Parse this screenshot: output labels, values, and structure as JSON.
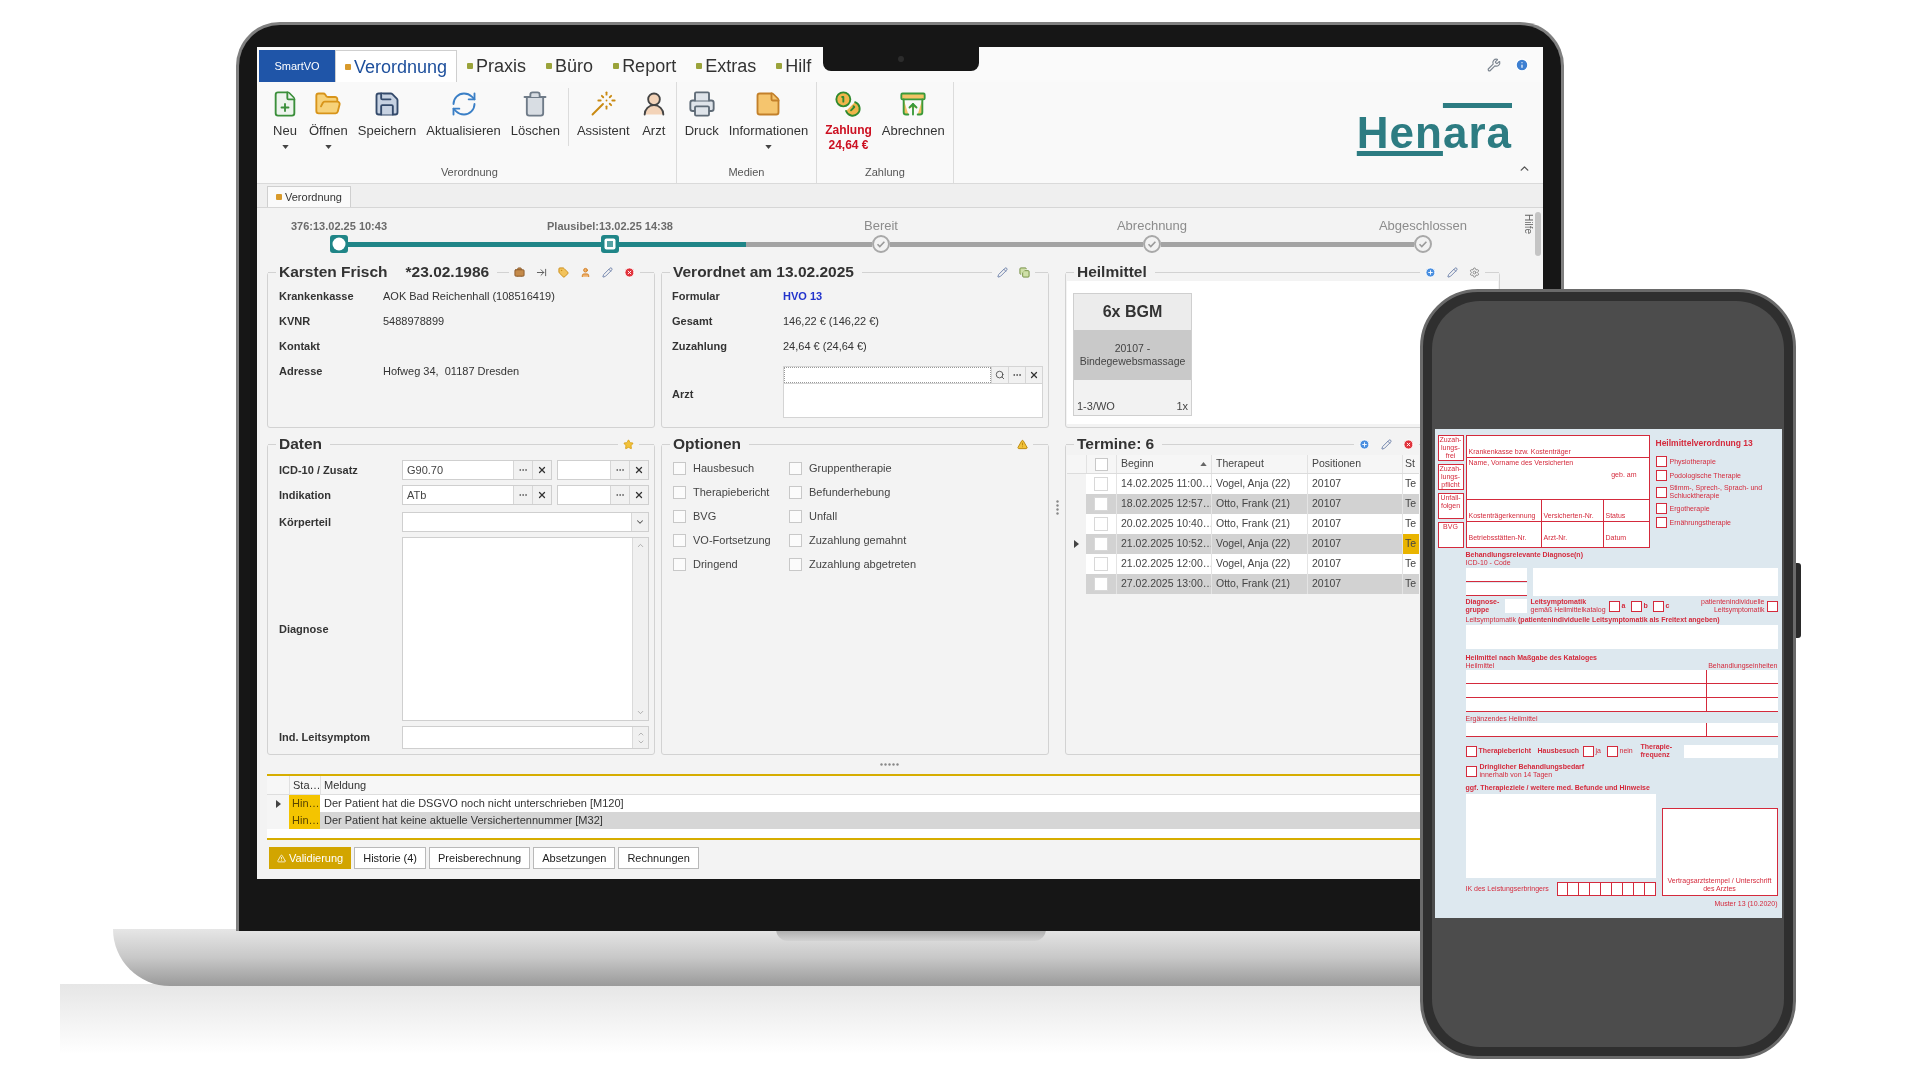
{
  "menu": {
    "app_button": "SmartVO",
    "tabs": [
      {
        "label": "Verordnung",
        "selected": true
      },
      {
        "label": "Praxis",
        "selected": false
      },
      {
        "label": "Büro",
        "selected": false
      },
      {
        "label": "Report",
        "selected": false
      },
      {
        "label": "Extras",
        "selected": false
      },
      {
        "label": "Hilf",
        "selected": false
      }
    ]
  },
  "ribbon": {
    "groups": [
      {
        "label": "Verordnung",
        "sections": [
          [
            {
              "kind": "new",
              "label": "Neu",
              "dropdown": true,
              "highlighted": false
            },
            {
              "kind": "open",
              "label": "Öffnen",
              "dropdown": true,
              "highlighted": false
            },
            {
              "kind": "save",
              "label": "Speichern",
              "dropdown": false,
              "highlighted": false
            },
            {
              "kind": "refresh",
              "label": "Aktualisieren",
              "dropdown": false,
              "highlighted": false
            },
            {
              "kind": "delete",
              "label": "Löschen",
              "dropdown": false,
              "highlighted": false
            }
          ],
          [
            {
              "kind": "assistant",
              "label": "Assistent",
              "dropdown": false,
              "highlighted": false
            },
            {
              "kind": "doctor",
              "label": "Arzt",
              "dropdown": false,
              "highlighted": false
            }
          ]
        ]
      },
      {
        "label": "Medien",
        "sections": [
          [
            {
              "kind": "print",
              "label": "Druck",
              "dropdown": false,
              "highlighted": false
            },
            {
              "kind": "info",
              "label": "Informationen",
              "dropdown": true,
              "highlighted": false
            }
          ]
        ]
      },
      {
        "label": "Zahlung",
        "sections": [
          [
            {
              "kind": "payment",
              "label": "Zahlung",
              "amount": "24,64 €",
              "dropdown": false,
              "highlighted": true
            },
            {
              "kind": "billing",
              "label": "Abrechnen",
              "dropdown": false,
              "highlighted": false
            }
          ]
        ]
      }
    ],
    "logo": {
      "part_1": "Hen",
      "part_2": "ara"
    }
  },
  "document_tab": "Verordnung",
  "timeline": {
    "steps": [
      {
        "label": "376:13.02.25 10:43",
        "completed": true,
        "current": false
      },
      {
        "label": "Plausibel:13.02.25 14:38",
        "completed": false,
        "current": true,
        "level": 0.5
      },
      {
        "label": "Bereit",
        "completed": false,
        "current": false
      },
      {
        "label": "Abrechnung",
        "completed": false,
        "current": false
      },
      {
        "label": "Abgeschlossen",
        "completed": false,
        "current": false
      }
    ]
  },
  "side_tab": "Hilfe",
  "patient": {
    "name": "Karsten Frisch",
    "birthdate": "*23.02.1986",
    "fields": [
      {
        "label": "Krankenkasse",
        "value": "AOK Bad Reichenhall (108516419)"
      },
      {
        "label": "KVNR",
        "value": "5488978899"
      },
      {
        "label": "Kontakt"
      },
      {
        "label": "Adresse",
        "value": "Hofweg 34,  01187 Dresden"
      }
    ]
  },
  "prescription": {
    "title": "Verordnet am 13.02.2025",
    "fields": [
      {
        "kind": "link",
        "label": "Formular",
        "value": "HVO 13"
      },
      {
        "kind": "text",
        "label": "Gesamt",
        "value": "146,22 € (146,22 €)"
      },
      {
        "kind": "text",
        "label": "Zuzahlung",
        "value": "24,64 € (24,64 €)"
      },
      {
        "kind": "lookup",
        "label": "Arzt"
      }
    ]
  },
  "remedies": {
    "title": "Heilmittel",
    "cards": [
      {
        "title": "6x BGM",
        "description": "20107 - Bindegewebsmassage",
        "frequency": "1-3/WO",
        "count": "1x"
      }
    ]
  },
  "data": {
    "title": "Daten",
    "rows": [
      {
        "kind": "pair",
        "label": "ICD-10 / Zusatz",
        "value": "G90.70"
      },
      {
        "kind": "pair",
        "label": "Indikation",
        "value": "ATb"
      },
      {
        "kind": "select",
        "label": "Körperteil"
      },
      {
        "kind": "textarea",
        "label": "Diagnose"
      },
      {
        "kind": "spin",
        "label": "Ind. Leitsymptom"
      }
    ]
  },
  "options": {
    "title": "Optionen",
    "items": [
      {
        "label": "Hausbesuch",
        "checked": false
      },
      {
        "label": "Therapiebericht",
        "checked": false
      },
      {
        "label": "BVG",
        "checked": false
      },
      {
        "label": "VO-Fortsetzung",
        "checked": false
      },
      {
        "label": "Dringend",
        "checked": false
      },
      {
        "label": "Gruppentherapie",
        "checked": false
      },
      {
        "label": "Befunderhebung",
        "checked": false
      },
      {
        "label": "Unfall",
        "checked": false
      },
      {
        "label": "Zuzahlung gemahnt",
        "checked": false
      },
      {
        "label": "Zuzahlung abgetreten",
        "checked": false
      }
    ]
  },
  "appointments": {
    "title": "Termine: 6",
    "select_all": {
      "checked": false
    },
    "columns": [
      {
        "label": "Beginn",
        "sorted": true
      },
      {
        "label": "Therapeut",
        "sorted": false
      },
      {
        "label": "Positionen",
        "sorted": false
      },
      {
        "label": "St",
        "sorted": false
      }
    ],
    "rows": [
      {
        "cells": [
          "14.02.2025 11:00…",
          "Vogel, Anja (22)",
          "20107",
          "Te"
        ],
        "checked": false,
        "current": false
      },
      {
        "cells": [
          "18.02.2025 12:57…",
          "Otto, Frank (21)",
          "20107",
          "Te"
        ],
        "checked": false,
        "current": false
      },
      {
        "cells": [
          "20.02.2025 10:40…",
          "Otto, Frank (21)",
          "20107",
          "Te"
        ],
        "checked": false,
        "current": false
      },
      {
        "cells": [
          "21.02.2025 10:52…",
          "Vogel, Anja (22)",
          "20107",
          "Te"
        ],
        "checked": false,
        "current": true
      },
      {
        "cells": [
          "21.02.2025 12:00…",
          "Vogel, Anja (22)",
          "20107",
          "Te"
        ],
        "checked": false,
        "current": false
      },
      {
        "cells": [
          "27.02.2025 13:00…",
          "Otto, Frank (21)",
          "20107",
          "Te"
        ],
        "checked": false,
        "current": false
      }
    ]
  },
  "messages": {
    "columns": [
      "Sta…",
      "Meldung"
    ],
    "rows": [
      {
        "status": "Hin…",
        "text": "Der Patient hat die DSGVO noch nicht unterschrieben [M120]",
        "current": true,
        "selected": false
      },
      {
        "status": "Hin…",
        "text": "Der Patient hat keine aktuelle Versichertennummer [M32]",
        "current": false,
        "selected": true
      }
    ]
  },
  "bottom_tabs": [
    {
      "label": "Validierung",
      "kind": "warning",
      "selected": true
    },
    {
      "label": "Historie (4)",
      "kind": "plain",
      "selected": false
    },
    {
      "label": "Preisberechnung",
      "kind": "plain",
      "selected": false
    },
    {
      "label": "Absetzungen",
      "kind": "plain",
      "selected": false
    },
    {
      "label": "Rechnungen",
      "kind": "plain",
      "selected": false
    }
  ],
  "phone_form": {
    "side_labels": [
      "Zuzah-lungs-frei",
      "Zuzah-lungs-pflicht",
      "Unfall-folgen",
      "BVG"
    ],
    "insured": {
      "payer": "Krankenkasse bzw. Kostenträger",
      "name": "Name, Vorname des Versicherten",
      "birth": "geb. am",
      "row_3": [
        "Kostenträgerkennung",
        "Versicherten-Nr.",
        "Status"
      ],
      "row_4": [
        "Betriebsstätten-Nr.",
        "Arzt-Nr.",
        "Datum"
      ]
    },
    "title": "Heilmittelverordnung 13",
    "therapies": [
      {
        "label": "Physiotherapie",
        "checked": false
      },
      {
        "label": "Podologische Therapie",
        "checked": false
      },
      {
        "label": "Stimm-, Sprech-, Sprach- und Schlucktherapie",
        "checked": false
      },
      {
        "label": "Ergotherapie",
        "checked": false
      },
      {
        "label": "Ernährungstherapie",
        "checked": false
      }
    ],
    "diagnosis_heading": "Behandlungsrelevante Diagnose(n)",
    "icd_label": "ICD-10 - Code",
    "group_label": "Diagnose-gruppe",
    "symptom_label": "Leitsymptomatik",
    "symptom_note": "gemäß Heilmittelkatalog",
    "symptom_options": [
      {
        "label": "a",
        "checked": false
      },
      {
        "label": "b",
        "checked": false
      },
      {
        "label": "c",
        "checked": false
      }
    ],
    "individual": {
      "label": "patientenindividuelle Leitsymptomatik",
      "checked": false
    },
    "freetext_label": "Leitsymptomatik **(patientenindividuelle Leitsymptomatik als Freitext angeben)**",
    "remedies_heading": "Heilmittel nach Maßgabe des Kataloges",
    "remedy_label": "Heilmittel",
    "units_label": "Behandlungseinheiten",
    "supplement_label": "Ergänzendes Heilmittel",
    "report": {
      "label": "Therapiebericht",
      "checked": false
    },
    "home_visit": {
      "label": "Hausbesuch",
      "options": [
        {
          "label": "ja",
          "checked": false
        },
        {
          "label": "nein",
          "checked": false
        }
      ]
    },
    "frequency_label": "Therapie-frequenz",
    "urgent": {
      "label": "Dringlicher Behandlungsbedarf",
      "note": "innerhalb von 14 Tagen",
      "checked": false
    },
    "goals_heading": "ggf. Therapieziele / weitere med. Befunde und Hinweise",
    "ik_label": "IK des Leistungserbringers",
    "stamp_label": "Vertragsarztstempel / Unterschrift des Arztes",
    "footer": "Muster 13 (10.2020)"
  }
}
